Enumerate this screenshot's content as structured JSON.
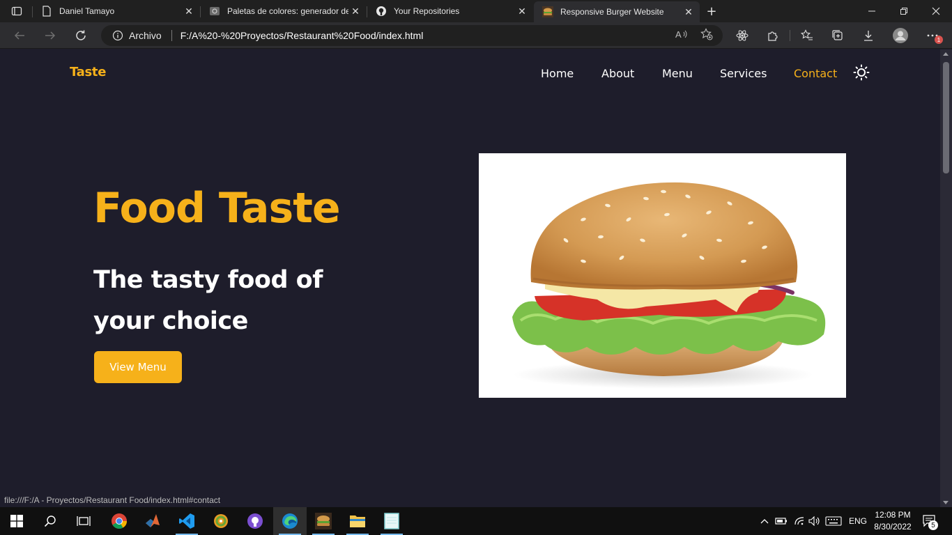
{
  "browser": {
    "tabs": [
      {
        "title": "Daniel Tamayo",
        "icon": "page-icon"
      },
      {
        "title": "Paletas de colores: generador de",
        "icon": "palette-site-icon"
      },
      {
        "title": "Your Repositories",
        "icon": "github-icon"
      },
      {
        "title": "Responsive Burger Website",
        "icon": "burger-favicon",
        "active": true
      }
    ],
    "address": {
      "site_label": "Archivo",
      "url": "F:/A%20-%20Proyectos/Restaurant%20Food/index.html"
    },
    "status_url": "file:///F:/A - Proyectos/Restaurant Food/index.html#contact",
    "notification_count": "1"
  },
  "page": {
    "logo": "Taste",
    "nav": [
      "Home",
      "About",
      "Menu",
      "Services",
      "Contact"
    ],
    "active_nav": "Contact",
    "hero": {
      "title": "Food Taste",
      "subtitle_line1": "The tasty food of",
      "subtitle_line2": "your choice",
      "cta": "View Menu"
    },
    "colors": {
      "accent": "#f6b11a",
      "background": "#1e1d2b",
      "text": "#ffffff"
    }
  },
  "taskbar": {
    "apps": [
      "windows-start-icon",
      "search-icon",
      "task-view-icon",
      "chrome-icon",
      "matlab-icon",
      "vscode-icon",
      "app-icon",
      "github-desktop-icon",
      "edge-icon",
      "burger-image-icon",
      "file-explorer-icon",
      "notepad-icon"
    ],
    "language": "ENG",
    "time": "12:08 PM",
    "date": "8/30/2022",
    "notifications": "5"
  }
}
